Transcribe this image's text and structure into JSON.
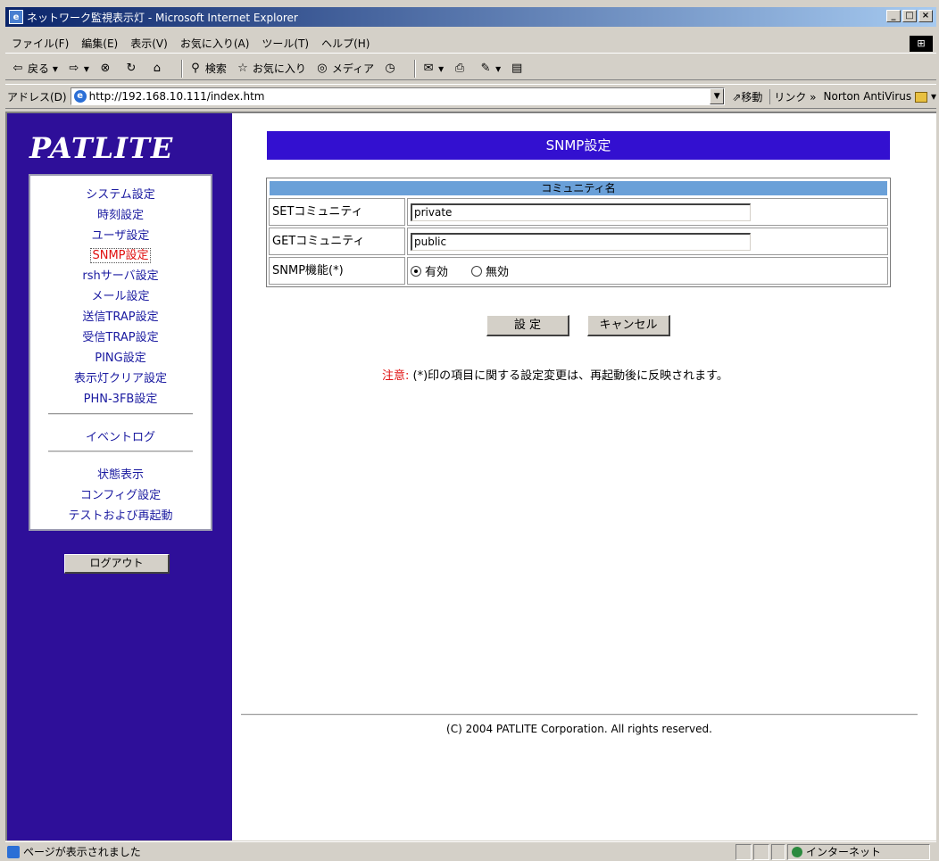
{
  "window": {
    "title": "ネットワーク監視表示灯 - Microsoft Internet Explorer"
  },
  "menu": [
    "ファイル(F)",
    "編集(E)",
    "表示(V)",
    "お気に入り(A)",
    "ツール(T)",
    "ヘルプ(H)"
  ],
  "toolbar": {
    "back": "戻る",
    "search": "検索",
    "favorites": "お気に入り",
    "media": "メディア"
  },
  "address": {
    "label": "アドレス(D)",
    "url": "http://192.168.10.111/index.htm",
    "go": "移動",
    "links": "リンク »",
    "norton": "Norton AntiVirus"
  },
  "sidebar": {
    "logo": "PATLITE",
    "items": [
      "システム設定",
      "時刻設定",
      "ユーザ設定",
      "SNMP設定",
      "rshサーバ設定",
      "メール設定",
      "送信TRAP設定",
      "受信TRAP設定",
      "PING設定",
      "表示灯クリア設定",
      "PHN-3FB設定"
    ],
    "event_log": "イベントログ",
    "items2": [
      "状態表示",
      "コンフィグ設定",
      "テストおよび再起動"
    ],
    "logout": "ログアウト"
  },
  "main": {
    "header": "SNMP設定",
    "table_header": "コミュニティ名",
    "set_label": "SETコミュニティ",
    "set_value": "private",
    "get_label": "GETコミュニティ",
    "get_value": "public",
    "snmp_label": "SNMP機能(*)",
    "enable": "有効",
    "disable": "無効",
    "enabled_selected": true,
    "submit": "設 定",
    "cancel": "キャンセル",
    "note_label": "注意:",
    "note_text": " (*)印の項目に関する設定変更は、再起動後に反映されます。",
    "footer": "(C) 2004 PATLITE Corporation. All rights reserved."
  },
  "status": {
    "text": "ページが表示されました",
    "zone": "インターネット"
  },
  "colors": {
    "sidebar_bg": "#2e0f99",
    "header_bg": "#3310d0",
    "table_header_bg": "#6aa0d8",
    "active_nav": "#e01010"
  }
}
